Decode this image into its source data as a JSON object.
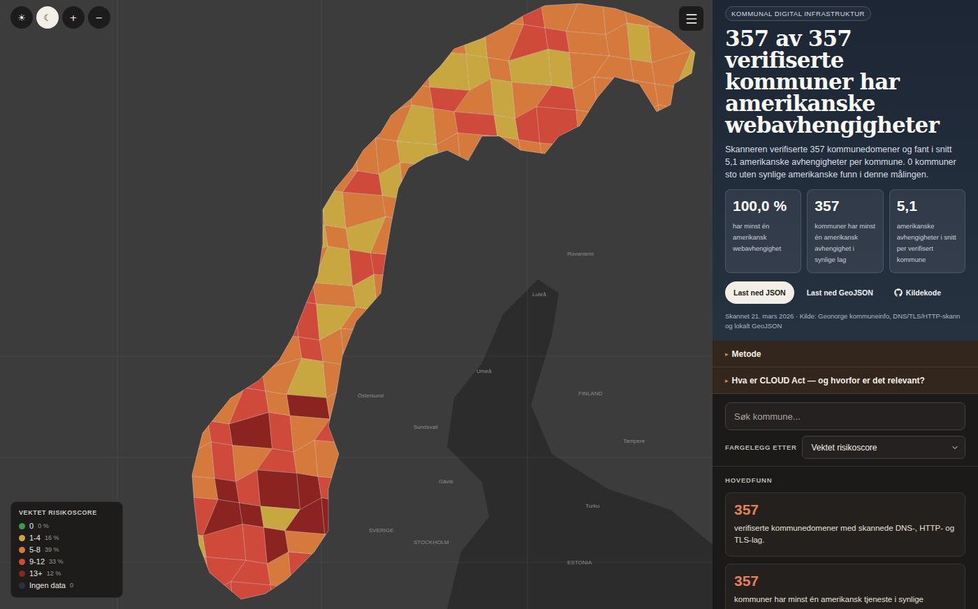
{
  "map_controls": {
    "theme_buttons": [
      {
        "label": "☀",
        "selected": false
      },
      {
        "label": "☾",
        "selected": true
      }
    ],
    "zoom_buttons": [
      "+",
      "−"
    ]
  },
  "map": {
    "place_labels": [
      "Rovaniemi",
      "Luleå",
      "Umeå",
      "Östersund",
      "Sundsvall",
      "FINLAND",
      "Gävle",
      "SVERIGE",
      "STOCKHOLM",
      "Tampere",
      "Turku",
      "ESTONIA"
    ],
    "region_classes": [
      [
        2,
        2,
        2,
        2,
        2,
        2,
        2,
        2,
        2,
        2,
        2,
        2,
        3,
        2,
        2,
        2,
        2,
        2,
        2
      ],
      [
        2,
        2,
        2,
        2,
        2,
        2,
        2,
        2,
        2,
        2,
        1,
        2,
        3,
        3,
        2,
        2,
        1,
        2,
        1
      ],
      [
        2,
        2,
        2,
        2,
        2,
        2,
        2,
        2,
        2,
        1,
        1,
        2,
        1,
        1,
        2,
        2,
        2,
        2,
        1
      ],
      [
        2,
        2,
        2,
        2,
        2,
        2,
        2,
        2,
        2,
        3,
        2,
        1,
        2,
        3,
        2,
        2,
        2,
        2,
        2
      ],
      [
        2,
        2,
        2,
        2,
        2,
        2,
        2,
        2,
        1,
        2,
        3,
        1,
        3,
        3,
        2,
        2,
        2,
        2,
        2
      ],
      [
        2,
        2,
        2,
        2,
        2,
        2,
        2,
        2,
        1,
        2,
        2,
        2,
        2,
        2,
        2,
        2,
        2,
        2,
        2
      ],
      [
        2,
        2,
        2,
        2,
        2,
        2,
        3,
        1,
        2,
        2,
        2,
        2,
        2,
        2,
        2,
        2,
        2,
        2,
        2
      ],
      [
        2,
        2,
        2,
        2,
        2,
        1,
        2,
        2,
        1,
        2,
        2,
        2,
        2,
        2,
        2,
        2,
        2,
        2,
        2
      ],
      [
        2,
        2,
        2,
        2,
        1,
        2,
        1,
        2,
        2,
        2,
        2,
        2,
        2,
        2,
        2,
        2,
        2,
        2,
        2
      ],
      [
        2,
        2,
        2,
        2,
        2,
        1,
        3,
        3,
        2,
        2,
        2,
        2,
        2,
        2,
        2,
        2,
        2,
        2,
        2
      ],
      [
        2,
        2,
        2,
        2,
        3,
        2,
        1,
        2,
        2,
        2,
        2,
        2,
        2,
        2,
        2,
        2,
        2,
        2,
        2
      ],
      [
        2,
        2,
        2,
        3,
        3,
        1,
        2,
        2,
        2,
        2,
        2,
        2,
        2,
        2,
        2,
        2,
        2,
        2,
        2
      ],
      [
        2,
        2,
        2,
        2,
        3,
        2,
        2,
        2,
        2,
        2,
        2,
        2,
        2,
        2,
        2,
        2,
        2,
        2,
        2
      ],
      [
        2,
        2,
        3,
        2,
        1,
        2,
        2,
        2,
        2,
        2,
        2,
        2,
        2,
        2,
        2,
        2,
        2,
        2,
        2
      ],
      [
        2,
        2,
        3,
        2,
        4,
        2,
        1,
        2,
        2,
        2,
        2,
        2,
        2,
        2,
        2,
        2,
        2,
        2,
        2
      ],
      [
        2,
        3,
        4,
        3,
        2,
        3,
        2,
        2,
        2,
        2,
        2,
        2,
        2,
        2,
        2,
        2,
        2,
        2,
        2
      ],
      [
        2,
        3,
        2,
        3,
        2,
        2,
        3,
        2,
        2,
        2,
        2,
        2,
        2,
        2,
        2,
        2,
        2,
        2,
        2
      ],
      [
        2,
        4,
        3,
        4,
        4,
        3,
        2,
        2,
        2,
        2,
        2,
        2,
        2,
        2,
        2,
        2,
        2,
        2,
        2
      ],
      [
        3,
        4,
        4,
        1,
        4,
        4,
        3,
        2,
        2,
        2,
        2,
        2,
        2,
        2,
        2,
        2,
        2,
        2,
        2
      ],
      [
        1,
        3,
        3,
        4,
        2,
        3,
        2,
        2,
        2,
        2,
        2,
        2,
        2,
        2,
        2,
        2,
        2,
        2,
        2
      ],
      [
        2,
        3,
        3,
        2,
        3,
        2,
        2,
        2,
        2,
        2,
        2,
        2,
        2,
        2,
        2,
        2,
        2,
        2,
        2
      ],
      [
        2,
        3,
        3,
        3,
        2,
        2,
        2,
        2,
        2,
        2,
        2,
        2,
        2,
        2,
        2,
        2,
        2,
        2,
        2
      ]
    ]
  },
  "legend": {
    "title": "VEKTET RISIKOSCORE",
    "items": [
      {
        "label": "0",
        "share": "0 %",
        "color": "#3f9b4a"
      },
      {
        "label": "1-4",
        "share": "16 %",
        "color": "#c8a640"
      },
      {
        "label": "5-8",
        "share": "39 %",
        "color": "#d57a3c"
      },
      {
        "label": "9-12",
        "share": "33 %",
        "color": "#cf4a3b"
      },
      {
        "label": "13+",
        "share": "12 %",
        "color": "#8b2420"
      },
      {
        "label": "Ingen data",
        "share": "0",
        "color": "#2a3340"
      }
    ]
  },
  "panel": {
    "badge": "KOMMUNAL DIGITAL INFRASTRUKTUR",
    "title": "357 av 357 verifiserte kommuner har amerikanske webavhengigheter",
    "intro": "Skanneren verifiserte 357 kommunedomener og fant i snitt 5,1 amerikanske avhengigheter per kommune. 0 kommuner sto uten synlige amerikanske funn i denne målingen.",
    "stats": [
      {
        "value": "100,0 %",
        "label": "har minst én amerikansk webavhengighet"
      },
      {
        "value": "357",
        "label": "kommuner har minst én amerikansk avhengighet i synlige lag"
      },
      {
        "value": "5,1",
        "label": "amerikanske avhengigheter i snitt per verifisert kommune"
      }
    ],
    "actions": [
      {
        "label": "Last ned JSON",
        "kind": "primary"
      },
      {
        "label": "Last ned GeoJSON",
        "kind": "plain"
      },
      {
        "label": "Kildekode",
        "kind": "source"
      }
    ],
    "meta": "Skannet 21. mars 2026 · Kilde: Geonorge kommuneinfo, DNS/TLS/HTTP-skann og lokalt GeoJSON",
    "accordions": [
      {
        "arrow": "▸",
        "label": "Metode",
        "expanded": false
      },
      {
        "arrow": "▸",
        "label": "Hva er CLOUD Act — og hvorfor er det relevant?",
        "expanded": false
      }
    ],
    "search": {
      "placeholder": "Søk kommune..."
    },
    "color_by": {
      "label": "FARGELEGG ETTER",
      "value": "Vektet risikoscore"
    },
    "findings_title": "HOVEDFUNN",
    "findings": [
      {
        "value": "357",
        "text": "verifiserte kommunedomener med skannede DNS-, HTTP- og TLS-lag."
      },
      {
        "value": "357",
        "text": "kommuner har minst én amerikansk tjeneste i synlige"
      }
    ]
  }
}
